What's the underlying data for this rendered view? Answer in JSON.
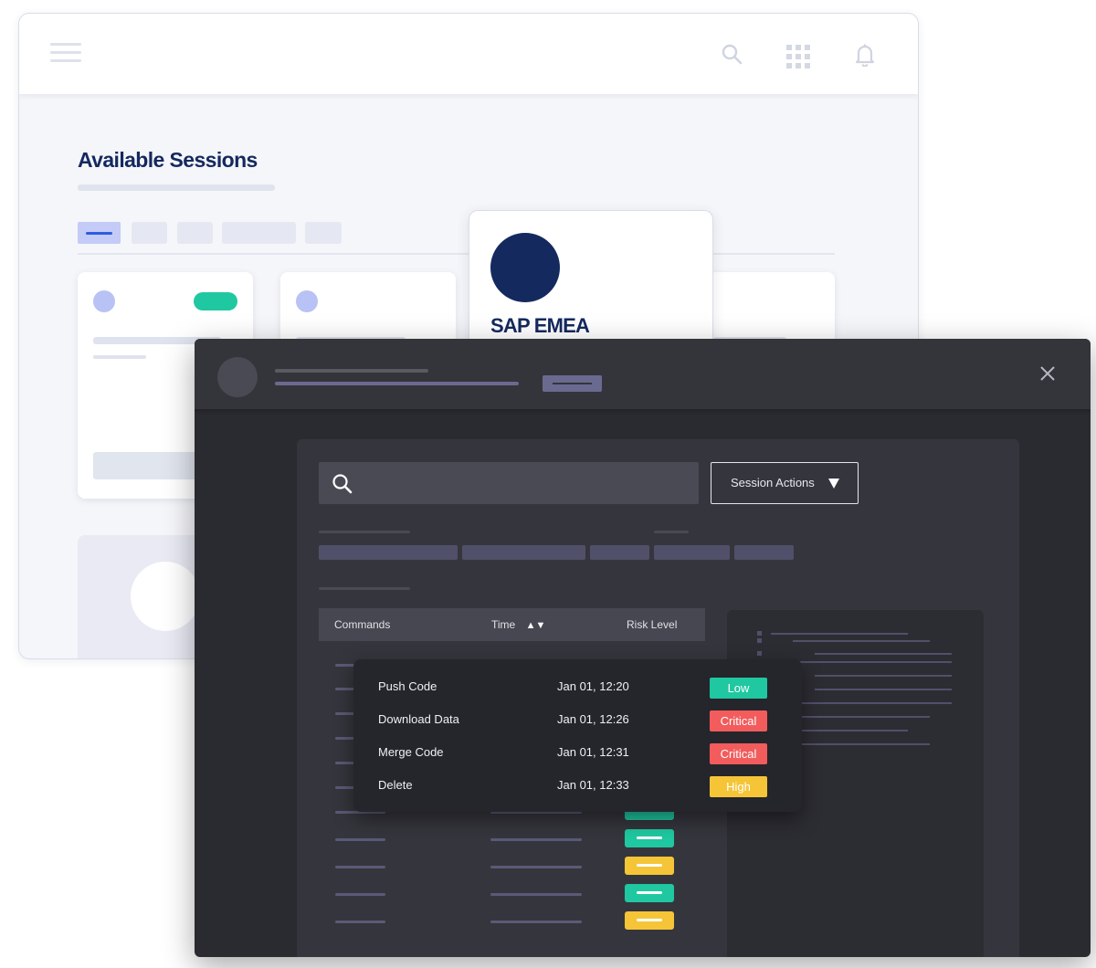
{
  "background_window": {
    "title": "Available Sessions",
    "featured_session": {
      "name": "SAP EMEA",
      "logo_color": "#14295e"
    },
    "accent_color": "#2f5be0",
    "status_color": "#1fc8a0"
  },
  "session_modal": {
    "session_actions_label": "Session Actions",
    "close_label": "✕",
    "table": {
      "columns": [
        "Commands",
        "Time",
        "Risk Level"
      ],
      "sort_indicator": "▲▼"
    },
    "highlighted_commands": [
      {
        "command": "Push Code",
        "time": "Jan 01, 12:20",
        "risk": "Low",
        "color": "#1fc8a0"
      },
      {
        "command": "Download Data",
        "time": "Jan 01, 12:26",
        "risk": "Critical",
        "color": "#f25c5c"
      },
      {
        "command": "Merge Code",
        "time": "Jan 01, 12:31",
        "risk": "Critical",
        "color": "#f25c5c"
      },
      {
        "command": "Delete",
        "time": "Jan 01, 12:33",
        "risk": "High",
        "color": "#f5c537"
      }
    ],
    "other_row_risk_colors": [
      "#1fc8a0",
      "#1fc8a0",
      "#f5c537",
      "#1fc8a0",
      "#f5c537"
    ]
  }
}
